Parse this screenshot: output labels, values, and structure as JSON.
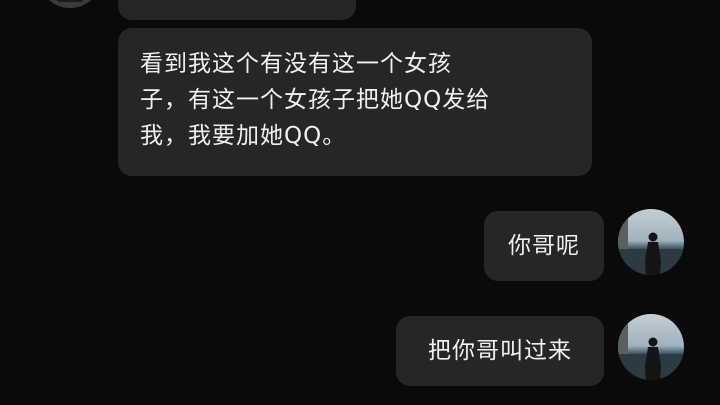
{
  "incoming": {
    "message_lines": [
      "看到我这个有没有这一个女孩",
      "子，有这一个女孩子把她QQ发给",
      "我，我要加她QQ。"
    ]
  },
  "outgoing": [
    {
      "text": "你哥呢"
    },
    {
      "text": "把你哥叫过来"
    }
  ],
  "colors": {
    "background": "#0a0a0a",
    "bubble": "#262626",
    "text": "#f1f1f1"
  },
  "icons": {
    "contact_avatar": "avatar-icon",
    "my_avatar": "seaside-silhouette-avatar-icon"
  }
}
